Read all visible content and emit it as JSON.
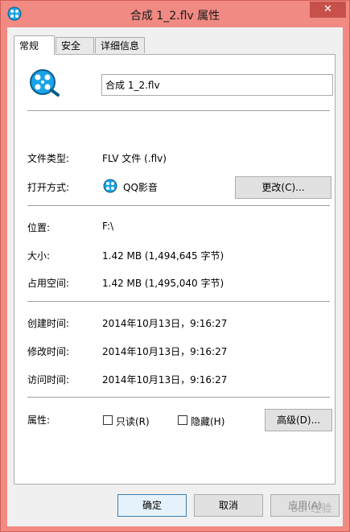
{
  "window": {
    "title": "合成 1_2.flv 属性",
    "close_label": "✕"
  },
  "tabs": [
    {
      "label": "常规",
      "active": true
    },
    {
      "label": "安全",
      "active": false
    },
    {
      "label": "详细信息",
      "active": false
    }
  ],
  "general": {
    "filename": "合成 1_2.flv",
    "file_type_label": "文件类型:",
    "file_type_value": "FLV 文件 (.flv)",
    "open_with_label": "打开方式:",
    "open_with_value": "QQ影音",
    "change_button": "更改(C)...",
    "location_label": "位置:",
    "location_value": "F:\\",
    "size_label": "大小:",
    "size_value": "1.42 MB (1,494,645 字节)",
    "disk_size_label": "占用空间:",
    "disk_size_value": "1.42 MB (1,495,040 字节)",
    "created_label": "创建时间:",
    "created_value": "2014年10月13日，9:16:27",
    "modified_label": "修改时间:",
    "modified_value": "2014年10月13日，9:16:27",
    "accessed_label": "访问时间:",
    "accessed_value": "2014年10月13日，9:16:27",
    "attributes_label": "属性:",
    "readonly_label": "只读(R)",
    "readonly_checked": false,
    "hidden_label": "隐藏(H)",
    "hidden_checked": false,
    "advanced_button": "高级(D)..."
  },
  "footer": {
    "ok": "确定",
    "cancel": "取消",
    "apply": "应用(A)"
  },
  "watermark": "Bai 经验",
  "colors": {
    "frame": "#f08a83",
    "close": "#c7504b",
    "icon_accent": "#1aa3e8"
  }
}
